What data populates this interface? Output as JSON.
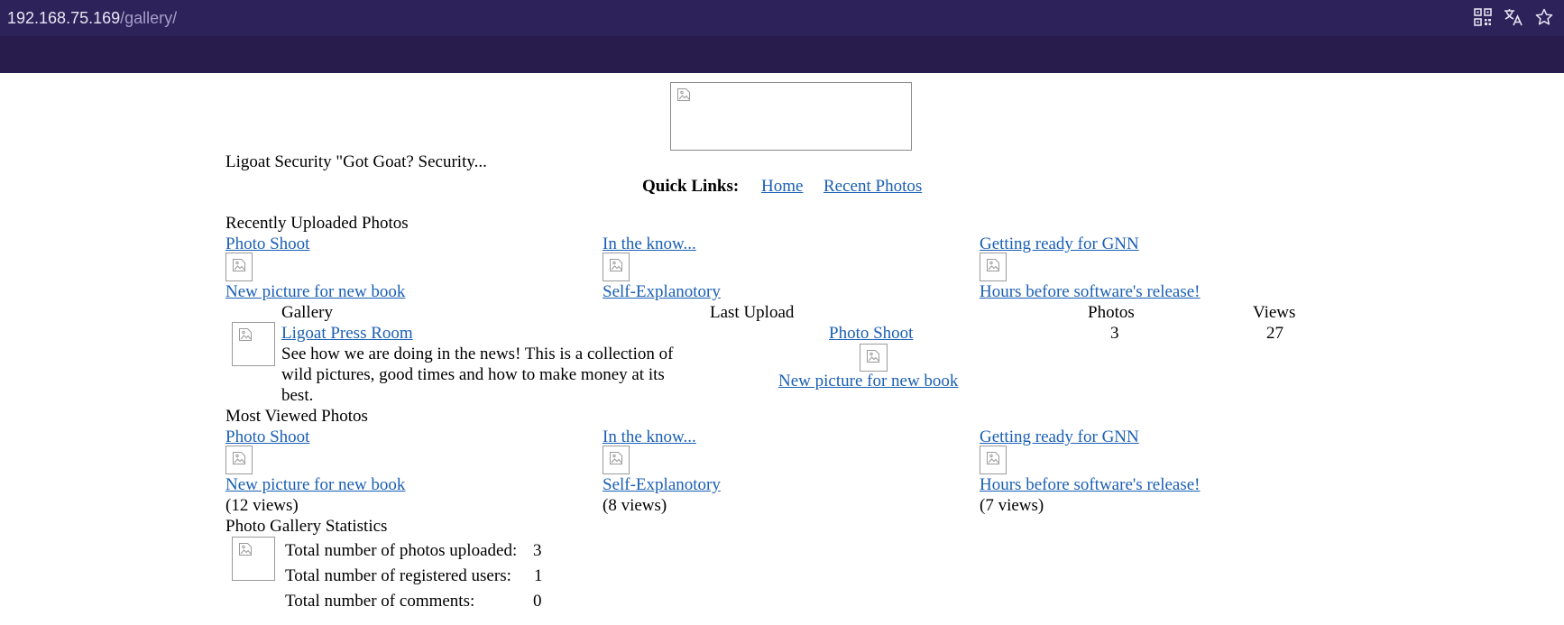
{
  "browser": {
    "url_host": "192.168.75.169",
    "url_path": "/gallery/",
    "icons": [
      "qr-code-icon",
      "translate-icon",
      "bookmark-star-icon"
    ]
  },
  "site": {
    "tagline": "Ligoat Security \"Got Goat? Security...",
    "quick_links_label": "Quick Links:",
    "quick_links": [
      "Home",
      "Recent Photos"
    ]
  },
  "recent": {
    "heading": "Recently Uploaded Photos",
    "items": [
      {
        "title": "Photo Shoot",
        "caption": "New picture for new book"
      },
      {
        "title": "In the know...",
        "caption": "Self-Explanotory"
      },
      {
        "title": "Getting ready for GNN",
        "caption": "Hours before software's release!"
      }
    ]
  },
  "gallery_table": {
    "headers": {
      "gallery": "Gallery",
      "last_upload": "Last Upload",
      "photos": "Photos",
      "views": "Views"
    },
    "row": {
      "name": "Ligoat Press Room",
      "description": "See how we are doing in the news! This is a collection of wild pictures, good times and how to make money at its best.",
      "desc_lines": [
        "See how we are doing in the news! This is a collection of",
        "wild pictures, good times and how to make money at its",
        "best."
      ],
      "last_upload_title": "Photo Shoot",
      "last_upload_caption": "New picture for new book",
      "photos": "3",
      "views": "27"
    }
  },
  "most_viewed": {
    "heading": "Most Viewed Photos",
    "items": [
      {
        "title": "Photo Shoot",
        "caption": "New picture for new book",
        "views": "(12 views)"
      },
      {
        "title": "In the know...",
        "caption": "Self-Explanotory",
        "views": "(8 views)"
      },
      {
        "title": "Getting ready for GNN",
        "caption": "Hours before software's release!",
        "views": "(7 views)"
      }
    ]
  },
  "stats": {
    "heading": "Photo Gallery Statistics",
    "rows": [
      {
        "label": "Total number of photos uploaded:",
        "value": "3"
      },
      {
        "label": "Total number of registered users:",
        "value": "1"
      },
      {
        "label": "Total number of comments:",
        "value": "0"
      }
    ]
  }
}
